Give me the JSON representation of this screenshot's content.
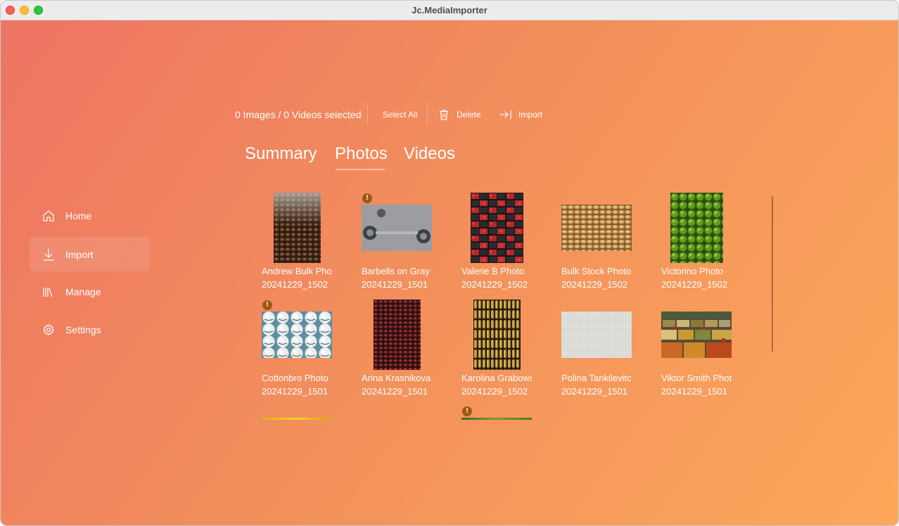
{
  "window": {
    "title": "Jc.MediaImporter"
  },
  "sidebar": {
    "items": [
      {
        "label": "Home",
        "icon": "home-icon"
      },
      {
        "label": "Import",
        "icon": "import-icon",
        "active": true
      },
      {
        "label": "Manage",
        "icon": "library-icon"
      },
      {
        "label": "Settings",
        "icon": "gear-icon"
      }
    ]
  },
  "toolbar": {
    "selection": "0 Images / 0 Videos selected",
    "select_all": "Select All",
    "delete": "Delete",
    "import": "Import"
  },
  "tabs": [
    {
      "label": "Summary"
    },
    {
      "label": "Photos",
      "active": true
    },
    {
      "label": "Videos"
    }
  ],
  "photos": [
    {
      "name": "Andrew Bulk Photo",
      "date": "20241229_1502",
      "thumb": "coffee-beans",
      "warning": false
    },
    {
      "name": "Barbells on Gray",
      "date": "20241229_1501",
      "thumb": "barbells",
      "warning": true
    },
    {
      "name": "Valerie B Photo",
      "date": "20241229_1502",
      "thumb": "berries-grid",
      "warning": false
    },
    {
      "name": "Bulk Stock Photo",
      "date": "20241229_1502",
      "thumb": "peanuts",
      "warning": false
    },
    {
      "name": "Victorino Photo",
      "date": "20241229_1502",
      "thumb": "limes",
      "warning": false
    },
    {
      "name": "Cottonbro Photo",
      "date": "20241229_1501",
      "thumb": "golf-balls",
      "warning": true
    },
    {
      "name": "Arina Krasnikova",
      "date": "20241229_1501",
      "thumb": "red-beans",
      "warning": false
    },
    {
      "name": "Karolina Grabowska",
      "date": "20241229_1502",
      "thumb": "bullets",
      "warning": false
    },
    {
      "name": "Polina Tankilevitch",
      "date": "20241229_1501",
      "thumb": "rice",
      "warning": false
    },
    {
      "name": "Viktor Smith Photo",
      "date": "20241229_1501",
      "thumb": "spices-market",
      "warning": false
    }
  ],
  "colors": {
    "gradient_start": "#ee7463",
    "gradient_end": "#fca85a",
    "warning_badge": "#9a5a12"
  }
}
